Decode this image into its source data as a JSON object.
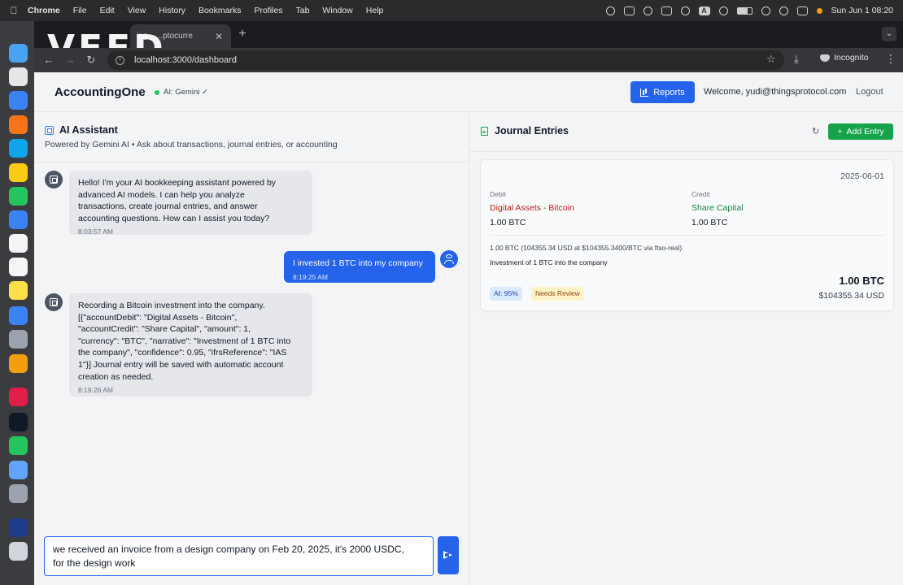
{
  "menubar": {
    "items": [
      "Chrome",
      "File",
      "Edit",
      "View",
      "History",
      "Bookmarks",
      "Profiles",
      "Tab",
      "Window",
      "Help"
    ],
    "datetime": "Sun Jun 1  08:20",
    "input_badge": "A"
  },
  "browser": {
    "tab_title": "ing - …ptocurre",
    "url": "localhost:3000/dashboard",
    "incognito_label": "Incognito",
    "watermark": "VEED"
  },
  "app": {
    "brand": "AccountingOne",
    "ai_status": "AI: Gemini ✓",
    "reports_label": "Reports",
    "welcome": "Welcome, yudi@thingsprotocol.com",
    "logout_label": "Logout"
  },
  "chat": {
    "title": "AI Assistant",
    "subtitle": "Powered by Gemini AI • Ask about transactions, journal entries, or accounting",
    "messages": [
      {
        "role": "assistant",
        "lines": [
          "Hello! I'm your AI bookkeeping assistant powered by",
          "advanced AI models. I can help you analyze",
          "transactions, create journal entries, and answer",
          "accounting questions. How can I assist you today?"
        ],
        "time": "8:03:57 AM"
      },
      {
        "role": "user",
        "lines": [
          "I invested 1 BTC into my company"
        ],
        "time": "8:19:25 AM"
      },
      {
        "role": "assistant",
        "lines": [
          "Recording a Bitcoin investment into the company.",
          "[{\"accountDebit\": \"Digital Assets - Bitcoin\",",
          "\"accountCredit\": \"Share Capital\", \"amount\": 1,",
          "\"currency\": \"BTC\", \"narrative\": \"Investment of 1 BTC into",
          "the company\", \"confidence\": 0.95, \"ifrsReference\": \"IAS",
          "1\"}] Journal entry will be saved with automatic account",
          "creation as needed."
        ],
        "time": "8:19:28 AM"
      }
    ],
    "input_lines": [
      "we received an invoice from a design company on Feb 20, 2025, it's 2000 USDC,",
      "for the design work"
    ]
  },
  "journal": {
    "title": "Journal Entries",
    "add_label": "Add Entry",
    "entry": {
      "date": "2025-06-01",
      "debit_label": "Debit",
      "credit_label": "Credit",
      "debit_account": "Digital Assets - Bitcoin",
      "credit_account": "Share Capital",
      "debit_amount": "1.00 BTC",
      "credit_amount": "1.00 BTC",
      "fx_note": "1.00 BTC (104355.34 USD at $104355.3400/BTC via ftso-real)",
      "narrative": "Investment of 1 BTC into the company",
      "ai_badge": "AI: 95%",
      "review_badge": "Needs Review",
      "total_btc": "1.00 BTC",
      "total_usd": "$104355.34 USD"
    }
  },
  "colors": {
    "primary": "#2563eb",
    "success": "#16a34a",
    "debit": "#b91c1c",
    "credit": "#15803d"
  },
  "dock_icons": [
    "finder-icon",
    "launchpad-icon",
    "safari-icon",
    "brave-icon",
    "edge-icon",
    "chrome-icon",
    "messages-icon",
    "mail-icon",
    "calendar-icon",
    "reminders-icon",
    "notes-icon",
    "app-store-icon",
    "system-settings-icon",
    "iphone-mirroring-icon",
    "slack-icon",
    "box-icon",
    "whatsapp-icon",
    "docker-icon",
    "quicktime-icon",
    "screen-icon",
    "trash-icon"
  ]
}
